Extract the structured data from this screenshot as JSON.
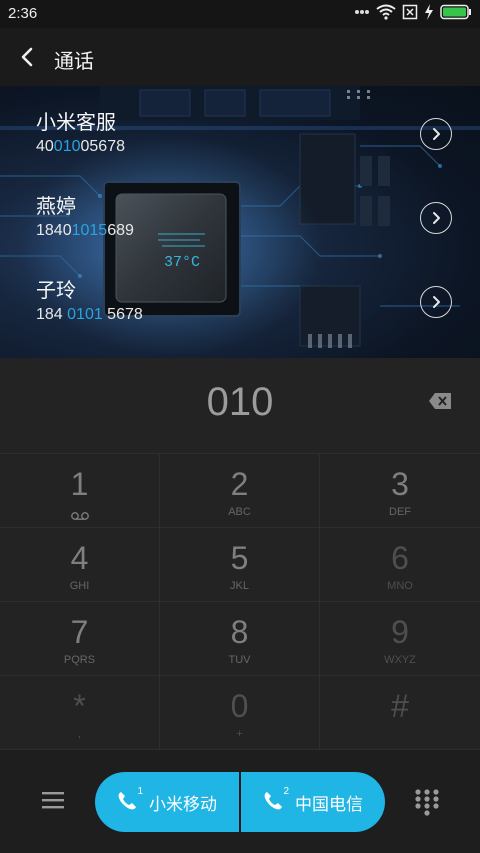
{
  "status_bar": {
    "time": "2:36",
    "icons": [
      "notification-dots-icon",
      "wifi-icon",
      "sim-disabled-icon",
      "charging-icon",
      "battery-icon"
    ]
  },
  "header": {
    "title": "通话"
  },
  "matches": [
    {
      "name": "小米客服",
      "num_pre": "40",
      "num_hl": "010",
      "num_post": "05678"
    },
    {
      "name": "燕婷",
      "num_pre": "1840",
      "num_hl": "1015",
      "num_post": "689"
    },
    {
      "name": "子玲",
      "num_pre": "184 ",
      "num_hl": "0101",
      "num_post": " 5678"
    }
  ],
  "hero": {
    "chip_text": "37°C"
  },
  "display": {
    "digits": "010"
  },
  "keypad": {
    "keys": [
      {
        "digit": "1",
        "letters": ""
      },
      {
        "digit": "2",
        "letters": "ABC"
      },
      {
        "digit": "3",
        "letters": "DEF"
      },
      {
        "digit": "4",
        "letters": "GHI"
      },
      {
        "digit": "5",
        "letters": "JKL"
      },
      {
        "digit": "6",
        "letters": "MNO"
      },
      {
        "digit": "7",
        "letters": "PQRS"
      },
      {
        "digit": "8",
        "letters": "TUV"
      },
      {
        "digit": "9",
        "letters": "WXYZ"
      },
      {
        "digit": "*",
        "letters": ","
      },
      {
        "digit": "0",
        "letters": "+"
      },
      {
        "digit": "#",
        "letters": ""
      }
    ]
  },
  "call_buttons": {
    "sim1_num": "1",
    "sim1_label": "小米移动",
    "sim2_num": "2",
    "sim2_label": "中国电信"
  },
  "colors": {
    "accent": "#1fb5e4",
    "highlight": "#2aa3e0"
  }
}
